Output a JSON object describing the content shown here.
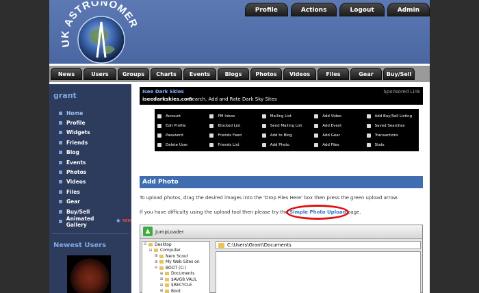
{
  "site": {
    "logo_text": "UK ASTRONOMERS"
  },
  "topnav": [
    "Profile",
    "Actions",
    "Logout",
    "Admin"
  ],
  "navbar": [
    "News",
    "Users",
    "Groups",
    "Charts",
    "Events",
    "Blogs",
    "Photos",
    "Videos",
    "Files",
    "Gear",
    "Buy/Sell"
  ],
  "sidebar": {
    "username": "grant",
    "items": [
      "Home",
      "Profile",
      "Widgets",
      "Friends",
      "Blog",
      "Events",
      "Photos",
      "Videos",
      "Files",
      "Gear",
      "Buy/Sell",
      "Animated Gallery"
    ],
    "new_badge": "NEW",
    "newest_users_title": "Newest Users"
  },
  "sponsor": {
    "title": "Isee Dark Skies",
    "url": "iseedarkskies.com",
    "description": "Search, Add and Rate Dark Sky Sites",
    "link_label": "Sponsored Link"
  },
  "actions": [
    "Account",
    "PM Inbox",
    "Mailing List",
    "Add Video",
    "Add Buy/Sell Listing",
    "Edit Profile",
    "Blocked List",
    "Send Mailing List",
    "Add Event",
    "Saved Searches",
    "Password",
    "Friends Feed",
    "Add to Blog",
    "Add Gear",
    "Transactions",
    "Delete User",
    "Friends List",
    "Add Photo",
    "Add Files",
    "Stats"
  ],
  "add_photo": {
    "title": "Add Photo",
    "instructions": "To upload photos, drag the desired images into the 'Drop Files Here' box then press the green upload arrow.",
    "difficulty_prefix": "If you have difficulty using the upload tool then please try the ",
    "simple_link": "Simple Photo Upload",
    "difficulty_suffix": " page."
  },
  "uploader": {
    "title": "JumpLoader",
    "path": "C:\\Users\\Grant\\Documents",
    "tree": [
      {
        "toggle": "⊟",
        "indent": 0,
        "label": "Desktop"
      },
      {
        "toggle": "⊟",
        "indent": 1,
        "label": "Computer"
      },
      {
        "toggle": "⊞",
        "indent": 2,
        "label": "Nero Scout"
      },
      {
        "toggle": "⊞",
        "indent": 2,
        "label": "My Web Sites on"
      },
      {
        "toggle": "⊟",
        "indent": 2,
        "label": "BOOT (C:)"
      },
      {
        "toggle": "⊞",
        "indent": 3,
        "label": "Documents"
      },
      {
        "toggle": "⊞",
        "indent": 3,
        "label": "$AVG8.VAUL"
      },
      {
        "toggle": "⊞",
        "indent": 3,
        "label": "$RECYCLE"
      },
      {
        "toggle": "⊞",
        "indent": 3,
        "label": "Boot"
      }
    ]
  }
}
